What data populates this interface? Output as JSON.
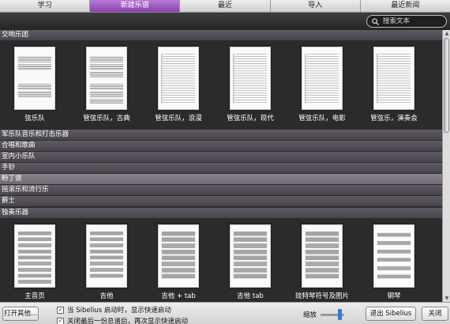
{
  "tabs": [
    {
      "label": "学习"
    },
    {
      "label": "新建乐谱"
    },
    {
      "label": "最近"
    },
    {
      "label": "导入"
    },
    {
      "label": "最近新闻"
    }
  ],
  "active_tab": "新建乐谱",
  "search": {
    "placeholder": "搜索文本"
  },
  "sections": {
    "orchestral": {
      "title": "交响乐团",
      "templates": [
        {
          "label": "弦乐队",
          "style": "strings"
        },
        {
          "label": "管弦乐队，古典",
          "style": "orchestra"
        },
        {
          "label": "管弦乐队，浪漫",
          "style": "dense"
        },
        {
          "label": "管弦乐队，现代",
          "style": "dense"
        },
        {
          "label": "管弦乐队，电影",
          "style": "dense"
        },
        {
          "label": "管弦乐，演奏会",
          "style": "dense"
        }
      ]
    },
    "middle_categories": [
      {
        "title": "军乐队音乐和打击乐器",
        "selected": false
      },
      {
        "title": "合唱和歌曲",
        "selected": false
      },
      {
        "title": "室内小乐队",
        "selected": false
      },
      {
        "title": "手钞",
        "selected": false
      },
      {
        "title": "粉丁谱",
        "selected": true
      },
      {
        "title": "摇滚乐和流行乐",
        "selected": false
      },
      {
        "title": "爵士",
        "selected": false
      }
    ],
    "solo": {
      "title": "独奏乐器",
      "templates": [
        {
          "label": "主音页",
          "style": "lead"
        },
        {
          "label": "吉他",
          "style": "staff"
        },
        {
          "label": "吉他 + tab",
          "style": "tabstaff"
        },
        {
          "label": "吉他 tab",
          "style": "tab"
        },
        {
          "label": "琉特琴符号及图片",
          "style": "tab"
        },
        {
          "label": "钢琴",
          "style": "piano"
        }
      ]
    }
  },
  "bottom": {
    "open_other": "打开其他...",
    "check1": "当 Sibelius 启动时，显示快速启动",
    "check2": "关闭最后一份总谱后，再次显示快速启动",
    "zoom_label": "缩放",
    "zoom_level": 0.75,
    "exit_button": "退出 Sibelius",
    "close_button": "关闭"
  },
  "colors": {
    "active_tab": "#9a4fc2",
    "selected_category": "#7d7481",
    "category": "#524d57"
  }
}
